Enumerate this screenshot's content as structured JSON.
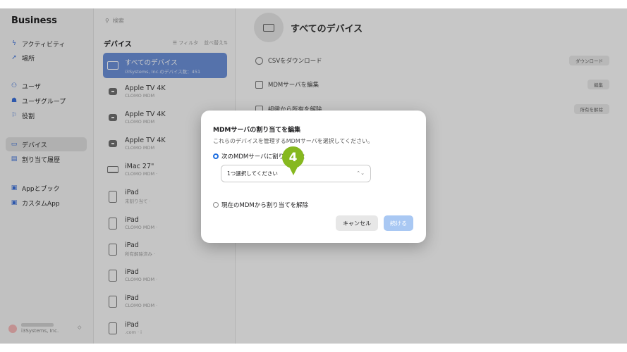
{
  "brand": {
    "apple": "",
    "name": "Business"
  },
  "sidebar": {
    "items": [
      {
        "label": "アクティビティ",
        "icon": "activity-icon",
        "glyph": "ϟ"
      },
      {
        "label": "場所",
        "icon": "location-arrow-icon",
        "glyph": "➚"
      },
      {
        "label": "ユーザ",
        "icon": "users-icon",
        "glyph": "⚇"
      },
      {
        "label": "ユーザグループ",
        "icon": "user-group-icon",
        "glyph": "☗"
      },
      {
        "label": "役割",
        "icon": "flag-icon",
        "glyph": "⚐"
      },
      {
        "label": "デバイス",
        "icon": "device-icon",
        "glyph": "▭"
      },
      {
        "label": "割り当て履歴",
        "icon": "history-list-icon",
        "glyph": "▤"
      },
      {
        "label": "Appとブック",
        "icon": "apps-icon",
        "glyph": "▣"
      },
      {
        "label": "カスタムApp",
        "icon": "custom-app-icon",
        "glyph": "▣"
      }
    ],
    "account_sub": "i3Systems, Inc.",
    "account_toggle": "◇"
  },
  "list": {
    "search_placeholder": "検索",
    "heading": "デバイス",
    "filter": "☰ フィルタ",
    "sort": "並べ替え⇅",
    "devices": [
      {
        "name": "すべてのデバイス",
        "sub": "i3Systems, Inc.のデバイス数：451",
        "kind": "all"
      },
      {
        "name": "Apple TV 4K",
        "sub": "CLOMO MDM",
        "kind": "tv"
      },
      {
        "name": "Apple TV 4K",
        "sub": "CLOMO MDM",
        "kind": "tv"
      },
      {
        "name": "Apple TV 4K",
        "sub": "CLOMO MDM",
        "kind": "tv"
      },
      {
        "name": "iMac 27\"",
        "sub": "CLOMO MDM ·",
        "kind": "mac"
      },
      {
        "name": "iPad",
        "sub": "未割り当て ·",
        "kind": "ipad"
      },
      {
        "name": "iPad",
        "sub": "CLOMO MDM ·",
        "kind": "ipad"
      },
      {
        "name": "iPad",
        "sub": "所有解除済み ·",
        "kind": "ipad"
      },
      {
        "name": "iPad",
        "sub": "CLOMO MDM ·",
        "kind": "ipad"
      },
      {
        "name": "iPad",
        "sub": "CLOMO MDM ·",
        "kind": "ipad"
      },
      {
        "name": "iPad",
        "sub": ".com · i",
        "kind": "ipad"
      }
    ]
  },
  "detail": {
    "title": "すべてのデバイス",
    "rows": [
      {
        "label": "CSVをダウンロード",
        "button": "ダウンロード"
      },
      {
        "label": "MDMサーバを編集",
        "button": "編集"
      },
      {
        "label": "組織から所有を解除",
        "button": "所有を解除"
      }
    ]
  },
  "modal": {
    "title": "MDMサーバの割り当てを編集",
    "description": "これらのデバイスを管理するMDMサーバを選択してください。",
    "option_assign": "次のMDMサーバに割り当てる：",
    "select_value": "1つ選択してください",
    "select_chevron": "⌃⌄",
    "option_unassign": "現在のMDMから割り当てを解除",
    "cancel_label": "キャンセル",
    "continue_label": "続ける"
  },
  "marker": {
    "number": "4",
    "color": "#86b81f"
  },
  "colors": {
    "accent": "#1f6fe0",
    "selected_row": "#6b8fd6",
    "continue_disabled": "#a9c8f3"
  }
}
